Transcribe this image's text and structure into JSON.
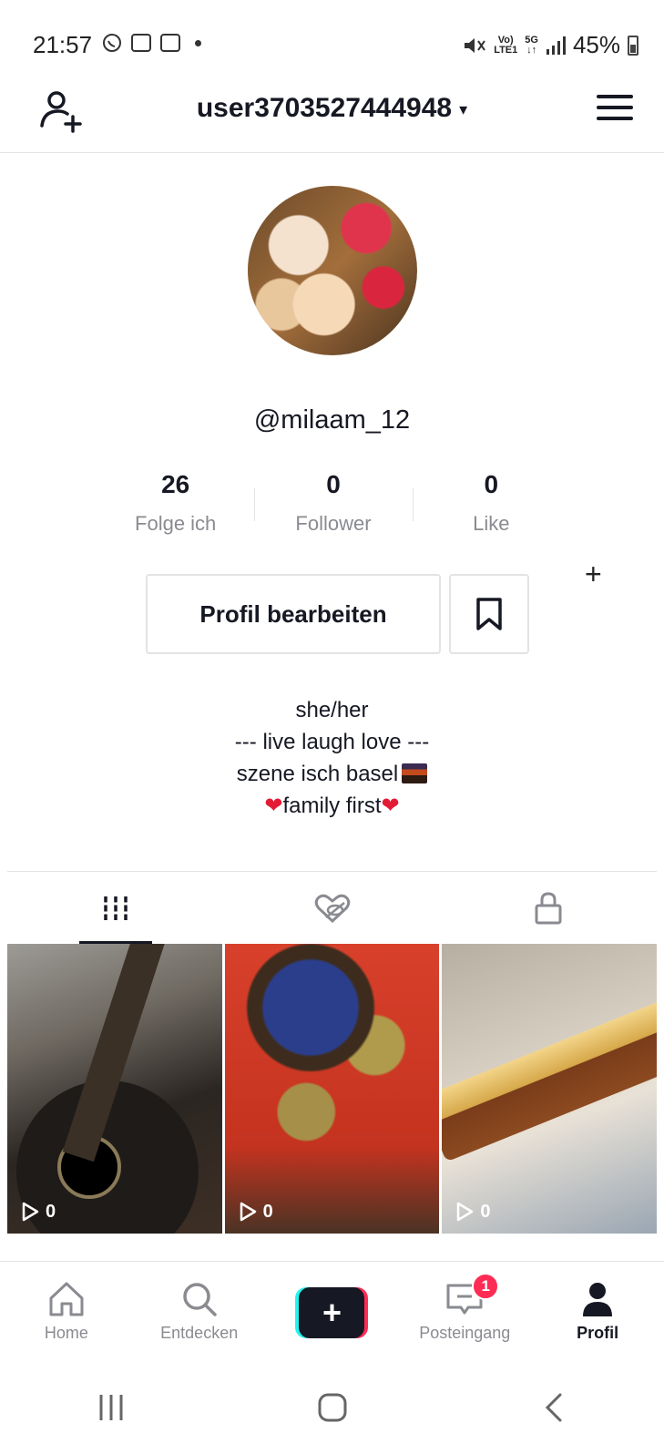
{
  "status_bar": {
    "time": "21:57",
    "battery": "45%"
  },
  "header": {
    "username": "user3703527444948",
    "caret": "▾"
  },
  "profile": {
    "handle": "@milaam_12",
    "stats": [
      {
        "value": "26",
        "label": "Folge ich"
      },
      {
        "value": "0",
        "label": "Follower"
      },
      {
        "value": "0",
        "label": "Like"
      }
    ],
    "edit_button_label": "Profil bearbeiten",
    "bio": {
      "line1": "she/her",
      "line2": "--- live laugh love ---",
      "line3": "szene isch basel",
      "line4_text": "family first",
      "heart": "❤"
    }
  },
  "videos": [
    {
      "views": "0"
    },
    {
      "views": "0"
    },
    {
      "views": "0"
    }
  ],
  "bottom_nav": {
    "items": [
      {
        "label": "Home"
      },
      {
        "label": "Entdecken"
      },
      {
        "label": "+"
      },
      {
        "label": "Posteingang",
        "badge": "1"
      },
      {
        "label": "Profil"
      }
    ]
  },
  "colors": {
    "accent": "#fe2c55",
    "cyan": "#25f4ee",
    "text": "#161823",
    "muted": "#8a8b91"
  }
}
